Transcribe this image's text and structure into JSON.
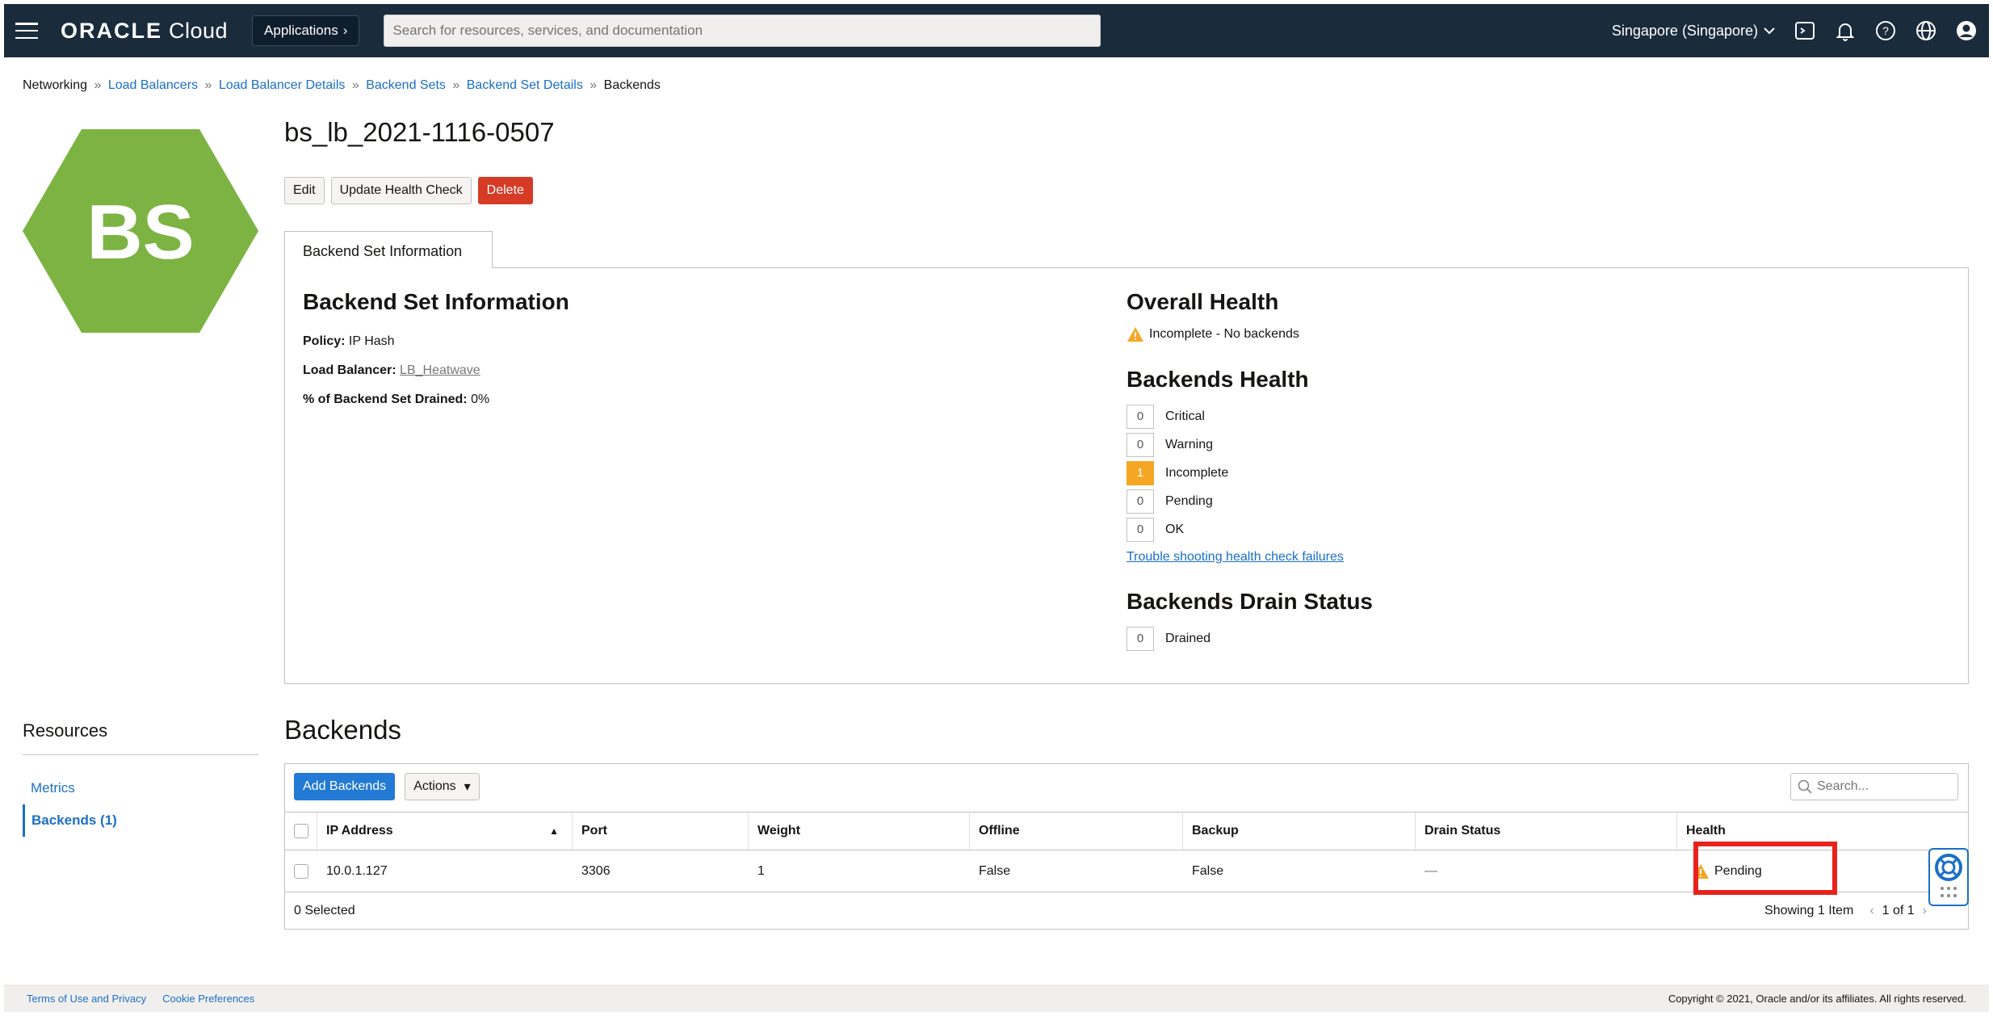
{
  "topbar": {
    "brand_bold": "ORACLE",
    "brand_thin": "Cloud",
    "applications_label": "Applications",
    "search_placeholder": "Search for resources, services, and documentation",
    "region": "Singapore (Singapore)",
    "icons": [
      "cloud-shell-icon",
      "bell-icon",
      "help-icon",
      "globe-icon",
      "user-icon"
    ]
  },
  "breadcrumb": {
    "root": "Networking",
    "items": [
      "Load Balancers",
      "Load Balancer Details",
      "Backend Sets",
      "Backend Set Details"
    ],
    "current": "Backends",
    "separator": "»"
  },
  "logo": {
    "text": "BS",
    "color": "#7cb342"
  },
  "page": {
    "title": "bs_lb_2021-1116-0507",
    "buttons": {
      "edit": "Edit",
      "update_health": "Update Health Check",
      "delete": "Delete"
    }
  },
  "info": {
    "tab_label": "Backend Set Information",
    "heading": "Backend Set Information",
    "policy_label": "Policy:",
    "policy_value": "IP Hash",
    "lb_label": "Load Balancer:",
    "lb_value": "LB_Heatwave",
    "drained_label": "% of Backend Set Drained:",
    "drained_value": "0%",
    "overall_heading": "Overall Health",
    "overall_status": "Incomplete - No backends",
    "backends_health_heading": "Backends Health",
    "health": [
      {
        "count": "0",
        "label": "Critical"
      },
      {
        "count": "0",
        "label": "Warning"
      },
      {
        "count": "1",
        "label": "Incomplete"
      },
      {
        "count": "0",
        "label": "Pending"
      },
      {
        "count": "0",
        "label": "OK"
      }
    ],
    "trouble_link": "Trouble shooting health check failures",
    "drain_heading": "Backends Drain Status",
    "drain_count": "0",
    "drain_label": "Drained"
  },
  "resources": {
    "title": "Resources",
    "items": [
      "Metrics",
      "Backends (1)"
    ]
  },
  "backends": {
    "title": "Backends",
    "add_button": "Add Backends",
    "actions_button": "Actions",
    "search_placeholder": "Search...",
    "columns": [
      "IP Address",
      "Port",
      "Weight",
      "Offline",
      "Backup",
      "Drain Status",
      "Health"
    ],
    "row": {
      "ip": "10.0.1.127",
      "port": "3306",
      "weight": "1",
      "offline": "False",
      "backup": "False",
      "drain_status": "—",
      "health": "Pending"
    },
    "selected": "0 Selected",
    "showing": "Showing 1 Item",
    "page": "1 of 1"
  },
  "footer": {
    "terms": "Terms of Use and Privacy",
    "cookies": "Cookie Preferences",
    "copyright": "Copyright © 2021, Oracle and/or its affiliates. All rights reserved."
  }
}
